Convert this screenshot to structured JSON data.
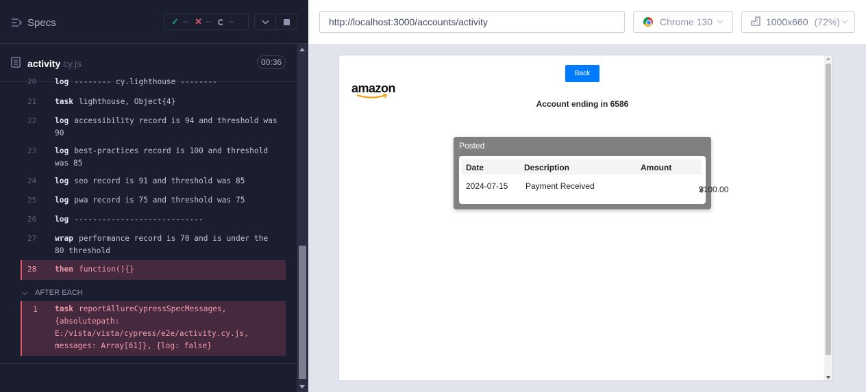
{
  "reporter": {
    "specs_label": "Specs",
    "stats": {
      "passed": "--",
      "failed": "--",
      "pending": "--"
    },
    "spec": {
      "name": "activity",
      "ext": ".cy.js",
      "duration": "00:36"
    },
    "commands": [
      {
        "num": "20",
        "kw": "log",
        "msg": "-------- cy.lighthouse --------"
      },
      {
        "num": "21",
        "kw": "task",
        "msg": "lighthouse, Object{4}"
      },
      {
        "num": "22",
        "kw": "log",
        "msg": "accessibility record is 94 and threshold was 90"
      },
      {
        "num": "23",
        "kw": "log",
        "msg": "best-practices record is 100 and threshold was 85"
      },
      {
        "num": "24",
        "kw": "log",
        "msg": "seo record is 91 and threshold was 85"
      },
      {
        "num": "25",
        "kw": "log",
        "msg": "pwa record is 75 and threshold was 75"
      },
      {
        "num": "26",
        "kw": "log",
        "msg": "----------------------------"
      },
      {
        "num": "27",
        "kw": "wrap",
        "msg": "performance record is 70 and is under the 80 threshold"
      },
      {
        "num": "28",
        "kw": "then",
        "msg": "function(){}"
      }
    ],
    "after_each_label": "AFTER EACH",
    "hook_command": {
      "num": "1",
      "kw": "task",
      "msg": "reportAllureCypressSpecMessages, {absolutepath: E:/vista/vista/cypress/e2e/activity.cy.js, messages: Array[61]}, {log: false}"
    }
  },
  "aut": {
    "url": "http://localhost:3000/accounts/activity",
    "browser": "Chrome 130",
    "viewport": "1000x660",
    "viewport_scale": "(72%)"
  },
  "app": {
    "back_label": "Back",
    "logo_text": "amazon",
    "account_title": "Account ending in 6586",
    "card_title": "Posted",
    "columns": [
      "Date",
      "Description",
      "Amount"
    ],
    "rows": [
      {
        "date": "2024-07-15",
        "description": "Payment Received",
        "check": "✓",
        "amount": "$100.00"
      }
    ]
  },
  "colors": {
    "reporter_bg": "#1b1e2e",
    "failed_bg": "#452a3f",
    "failed_text": "#f59aa9",
    "back_button": "#007bff",
    "card_bg": "#808080"
  }
}
